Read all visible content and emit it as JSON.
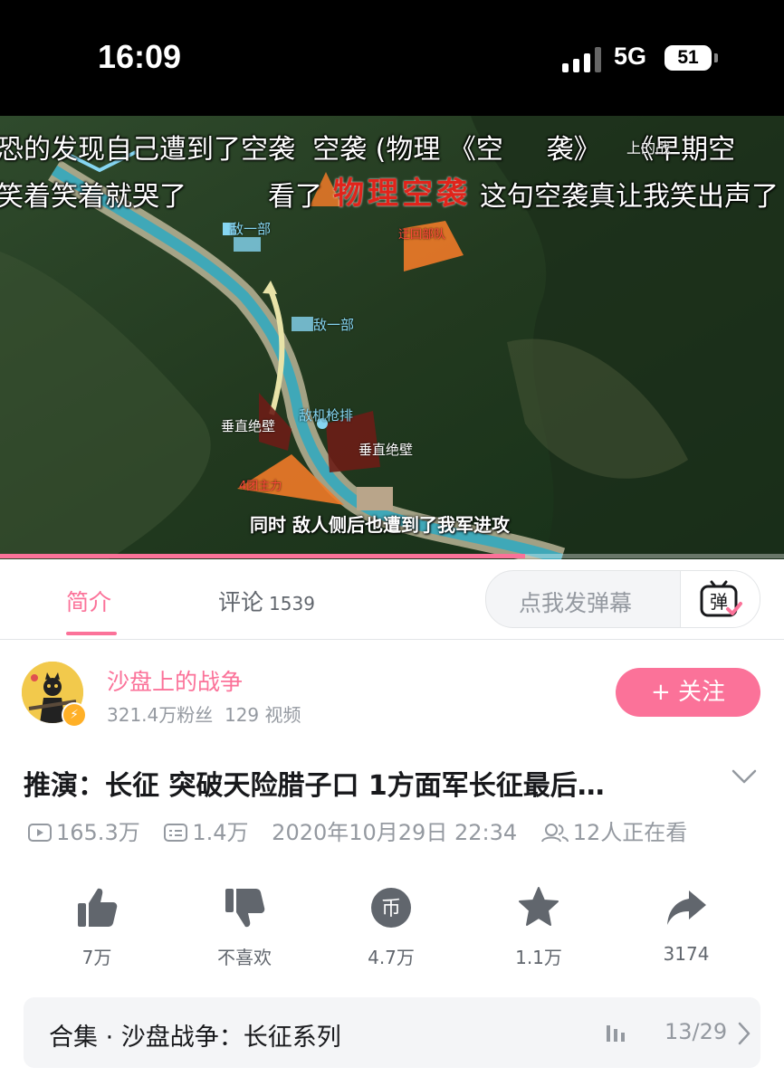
{
  "status_bar": {
    "time": "16:09",
    "network": "5G",
    "battery": "51"
  },
  "video": {
    "danmaku": [
      "恐的发现自己遭到了空袭",
      "空袭 (物理 《空",
      "袭》",
      "《早期空",
      "笑着笑着就哭了",
      "看了",
      "这句空袭真让我笑出声了"
    ],
    "danmaku_red": "物理空袭",
    "danmaku_tag": "上的战",
    "map_labels": {
      "enemy_hq": "敌一部",
      "enemy_unit": "敌一部",
      "retreat": "迂回部队",
      "mg_platoon": "敌机枪排",
      "cliff_left": "垂直绝壁",
      "cliff_right": "垂直绝壁",
      "main_force": "4团主力"
    },
    "subtitle": "同时 敌人侧后也遭到了我军进攻",
    "progress": 0.67
  },
  "tabs": {
    "intro": "简介",
    "comments": "评论",
    "comments_count": "1539",
    "danmaku_placeholder": "点我发弹幕",
    "danmaku_btn": "弹"
  },
  "uploader": {
    "name": "沙盘上的战争",
    "fans": "321.4万粉丝",
    "videos": "129 视频",
    "follow": "+ 关注"
  },
  "video_info": {
    "title": "推演：长征 突破天险腊子口 1方面军长征最后…",
    "views": "165.3万",
    "danmaku_count": "1.4万",
    "date": "2020年10月29日 22:34",
    "watching": "12人正在看"
  },
  "actions": {
    "like": "7万",
    "dislike": "不喜欢",
    "coin": "4.7万",
    "coin_glyph": "币",
    "favorite": "1.1万",
    "share": "3174"
  },
  "collection": {
    "label": "合集 · 沙盘战争：长征系列",
    "progress": "13/29"
  },
  "colors": {
    "accent": "#fb7299",
    "muted": "#9499a0",
    "text": "#18191c"
  }
}
